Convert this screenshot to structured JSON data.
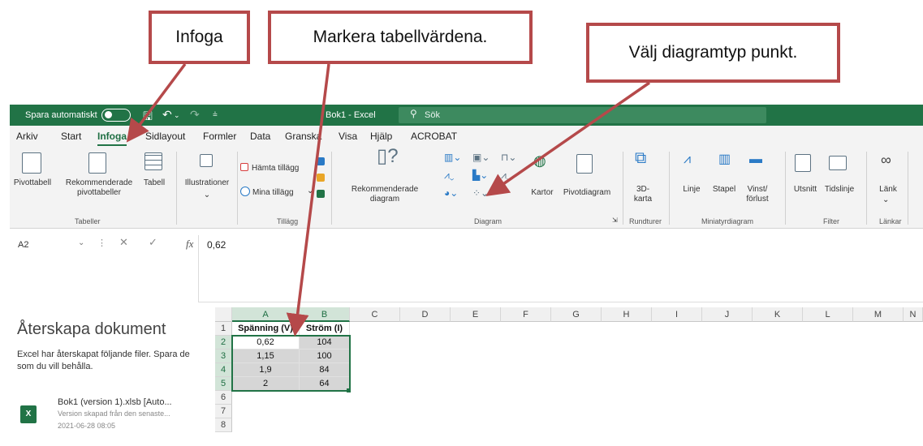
{
  "callouts": {
    "insert": "Infoga",
    "select_values": "Markera tabellvärdena.",
    "choose_chart": "Välj diagramtyp punkt."
  },
  "titlebar": {
    "autosave": "Spara automatiskt",
    "title": "Bok1 - Excel",
    "search_placeholder": "Sök"
  },
  "menu": {
    "tabs": [
      "Arkiv",
      "Start",
      "Infoga",
      "Sidlayout",
      "Formler",
      "Data",
      "Granska",
      "Visa",
      "Hjälp",
      "ACROBAT"
    ],
    "active": "Infoga"
  },
  "ribbon": {
    "pivot_table": "Pivottabell",
    "recommended_pivot_1": "Rekommenderade",
    "recommended_pivot_2": "pivottabeller",
    "table": "Tabell",
    "illustrations": "Illustrationer",
    "get_addins": "Hämta tillägg",
    "my_addins": "Mina tillägg",
    "recommended_charts_1": "Rekommenderade",
    "recommended_charts_2": "diagram",
    "maps": "Kartor",
    "pivot_chart": "Pivotdiagram",
    "map3d_1": "3D-",
    "map3d_2": "karta",
    "line": "Linje",
    "column": "Stapel",
    "winloss_1": "Vinst/",
    "winloss_2": "förlust",
    "slicer": "Utsnitt",
    "timeline": "Tidslinje",
    "link": "Länk",
    "group_tables": "Tabeller",
    "group_addins": "Tillägg",
    "group_charts": "Diagram",
    "group_tours": "Rundturer",
    "group_sparklines": "Miniatyrdiagram",
    "group_filter": "Filter",
    "group_links": "Länkar"
  },
  "formula_bar": {
    "name_box": "A2",
    "fx": "fx",
    "value": "0,62"
  },
  "recovery": {
    "title": "Återskapa dokument",
    "text": "Excel har återskapat följande filer. Spara de som du vill behålla.",
    "file_name": "Bok1 (version 1).xlsb  [Auto...",
    "file_sub": "Version skapad från den senaste...",
    "file_date": "2021-06-28 08:05",
    "file_icon": "X"
  },
  "sheet": {
    "columns": [
      "A",
      "B",
      "C",
      "D",
      "E",
      "F",
      "G",
      "H",
      "I",
      "J",
      "K",
      "L",
      "M",
      "N"
    ],
    "rows": [
      "1",
      "2",
      "3",
      "4",
      "5",
      "6",
      "7",
      "8"
    ],
    "header": [
      "Spänning (V)",
      "Ström (I)"
    ],
    "data": [
      [
        "0,62",
        "104"
      ],
      [
        "1,15",
        "100"
      ],
      [
        "1,9",
        "84"
      ],
      [
        "2",
        "64"
      ]
    ]
  },
  "colors": {
    "excel_green": "#217346",
    "callout_border": "#b5494a"
  }
}
